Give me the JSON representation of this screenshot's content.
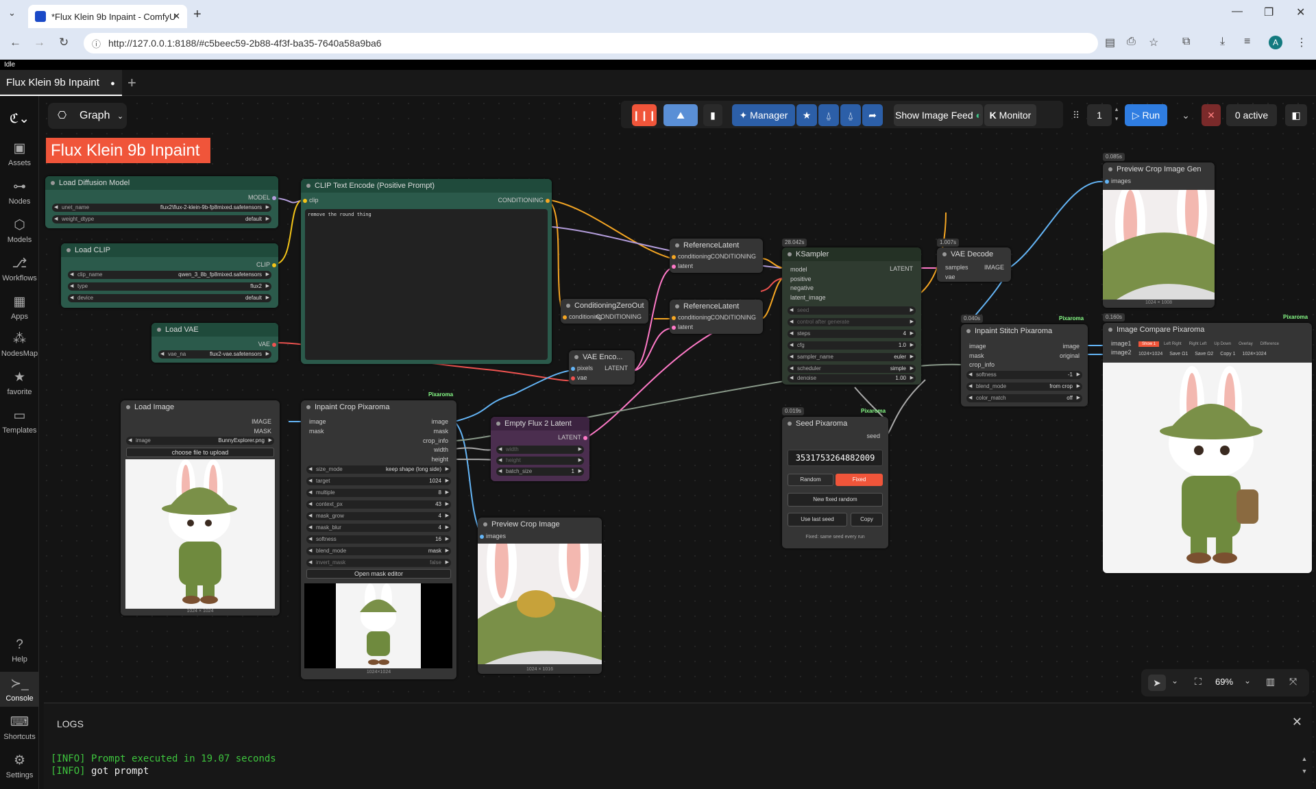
{
  "browser": {
    "tab_title": "*Flux Klein 9b Inpaint - ComfyU",
    "url": "http://127.0.0.1:8188/#c5beec59-2b88-4f3f-ba35-7640a58a9ba6",
    "avatar": "A"
  },
  "status": "Idle",
  "workspace_tab": "Flux Klein 9b Inpaint",
  "sidebar": [
    {
      "label": "Assets",
      "icon": "assets-icon"
    },
    {
      "label": "Nodes",
      "icon": "nodes-icon"
    },
    {
      "label": "Models",
      "icon": "models-icon"
    },
    {
      "label": "Workflows",
      "icon": "workflows-icon"
    },
    {
      "label": "Apps",
      "icon": "apps-icon"
    },
    {
      "label": "NodesMap",
      "icon": "nodesmap-icon"
    },
    {
      "label": "favorite",
      "icon": "star-icon"
    },
    {
      "label": "Templates",
      "icon": "templates-icon"
    },
    {
      "label": "Help",
      "icon": "help-icon"
    },
    {
      "label": "Console",
      "icon": "console-icon"
    },
    {
      "label": "Shortcuts",
      "icon": "keyboard-icon"
    },
    {
      "label": "Settings",
      "icon": "gear-icon"
    }
  ],
  "graph_button": "Graph",
  "title_banner": "Flux Klein 9b Inpaint",
  "toolbar": {
    "manager": "Manager",
    "show_image_feed": "Show Image Feed",
    "monitor": "Monitor",
    "batch_count": "1",
    "run": "Run",
    "active": "0 active"
  },
  "nodes": {
    "load_diffusion": {
      "title": "Load Diffusion Model",
      "out": "MODEL",
      "w1_label": "unet_name",
      "w1_value": "flux2\\flux-2-klein-9b-fp8mixed.safetensors",
      "w2_label": "weight_dtype",
      "w2_value": "default"
    },
    "load_clip": {
      "title": "Load CLIP",
      "out": "CLIP",
      "w1_label": "clip_name",
      "w1_value": "qwen_3_8b_fp8mixed.safetensors",
      "w2_label": "type",
      "w2_value": "flux2",
      "w3_label": "device",
      "w3_value": "default"
    },
    "load_vae": {
      "title": "Load VAE",
      "out": "VAE",
      "w1_label": "vae_na",
      "w1_value": "flux2-vae.safetensors"
    },
    "clip_text": {
      "title": "CLIP Text Encode (Positive Prompt)",
      "in": "clip",
      "out": "CONDITIONING",
      "prompt": "remove the round thing"
    },
    "cond_zero": {
      "title": "ConditioningZeroOut",
      "in": "conditioning",
      "out": "CONDITIONING"
    },
    "ref_latent1": {
      "title": "ReferenceLatent",
      "in1": "conditioning",
      "in2": "latent",
      "out": "CONDITIONING"
    },
    "ref_latent2": {
      "title": "ReferenceLatent",
      "in1": "conditioning",
      "in2": "latent",
      "out": "CONDITIONING"
    },
    "vae_encode": {
      "title": "VAE Enco...",
      "in1": "pixels",
      "in2": "vae",
      "out": "LATENT"
    },
    "ksampler": {
      "title": "KSampler",
      "time": "28.042s",
      "inputs": [
        "model",
        "positive",
        "negative",
        "latent_image"
      ],
      "out": "LATENT",
      "seed": "seed",
      "control": "control after generate",
      "steps": "4",
      "cfg": "1.0",
      "sampler_name": "euler",
      "scheduler": "simple",
      "denoise": "1.00",
      "labels": [
        "steps",
        "cfg",
        "sampler_name",
        "scheduler",
        "denoise"
      ]
    },
    "vae_decode": {
      "title": "VAE Decode",
      "time": "1.007s",
      "in1": "samples",
      "in2": "vae",
      "out": "IMAGE"
    },
    "preview_gen": {
      "title": "Preview Crop Image Gen",
      "time": "0.085s",
      "in": "images",
      "caption": "1024 × 1008"
    },
    "stitch": {
      "title": "Inpaint Stitch Pixaroma",
      "time": "0.040s",
      "tag": "Pixaroma",
      "inputs": [
        "image",
        "mask",
        "crop_info"
      ],
      "outputs": [
        "image",
        "original"
      ],
      "softness": "-1",
      "blend_mode": "from crop",
      "color_match": "off",
      "labels": [
        "softness",
        "blend_mode",
        "color_match"
      ]
    },
    "compare": {
      "title": "Image Compare Pixaroma",
      "time": "0.160s",
      "tag": "Pixaroma",
      "inputs": [
        "image1",
        "image2"
      ],
      "tabs": [
        "Show 1",
        "Left Right",
        "Right Left",
        "Up Down",
        "Overlay",
        "Difference"
      ],
      "size1": "1024×1024",
      "save1": "Save Ω1",
      "save2": "Save Ω2",
      "copy": "Copy 1",
      "size2": "1024×1024"
    },
    "load_image": {
      "title": "Load Image",
      "outs": [
        "IMAGE",
        "MASK"
      ],
      "w_label": "image",
      "w_value": "BunnyExplorer.png",
      "upload": "choose file to upload",
      "caption": "1024 × 1024"
    },
    "inpaint_crop": {
      "title": "Inpaint Crop Pixaroma",
      "tag": "Pixaroma",
      "inputs": [
        "image",
        "mask"
      ],
      "outputs": [
        "image",
        "mask",
        "crop_info",
        "width",
        "height"
      ],
      "widgets": [
        [
          "size_mode",
          "keep shape (long side)"
        ],
        [
          "target",
          "1024"
        ],
        [
          "multiple",
          "8"
        ],
        [
          "context_px",
          "43"
        ],
        [
          "mask_grow",
          "4"
        ],
        [
          "mask_blur",
          "4"
        ],
        [
          "softness",
          "16"
        ],
        [
          "blend_mode",
          "mask"
        ]
      ],
      "invert_label": "invert_mask",
      "invert_value": "false",
      "editor": "Open mask editor",
      "caption": "1024×1024"
    },
    "empty_latent": {
      "title": "Empty Flux 2 Latent",
      "out": "LATENT",
      "w1": "width",
      "w2": "height",
      "w3_label": "batch_size",
      "w3_value": "1"
    },
    "preview_crop": {
      "title": "Preview Crop Image",
      "in": "images",
      "caption": "1024 × 1016"
    },
    "seed": {
      "title": "Seed Pixaroma",
      "time": "0.019s",
      "tag": "Pixaroma",
      "out": "seed",
      "value": "3531753264882009",
      "random": "Random",
      "fixed": "Fixed",
      "new_fixed": "New fixed random",
      "use_last": "Use last seed",
      "copy": "Copy",
      "note": "Fixed: same seed every run"
    }
  },
  "zoom": "69%",
  "logs": {
    "title": "LOGS",
    "lines": [
      {
        "tag": "[INFO]",
        "text": "Prompt executed in 19.07 seconds"
      },
      {
        "tag": "[INFO]",
        "text": "got prompt"
      }
    ]
  }
}
